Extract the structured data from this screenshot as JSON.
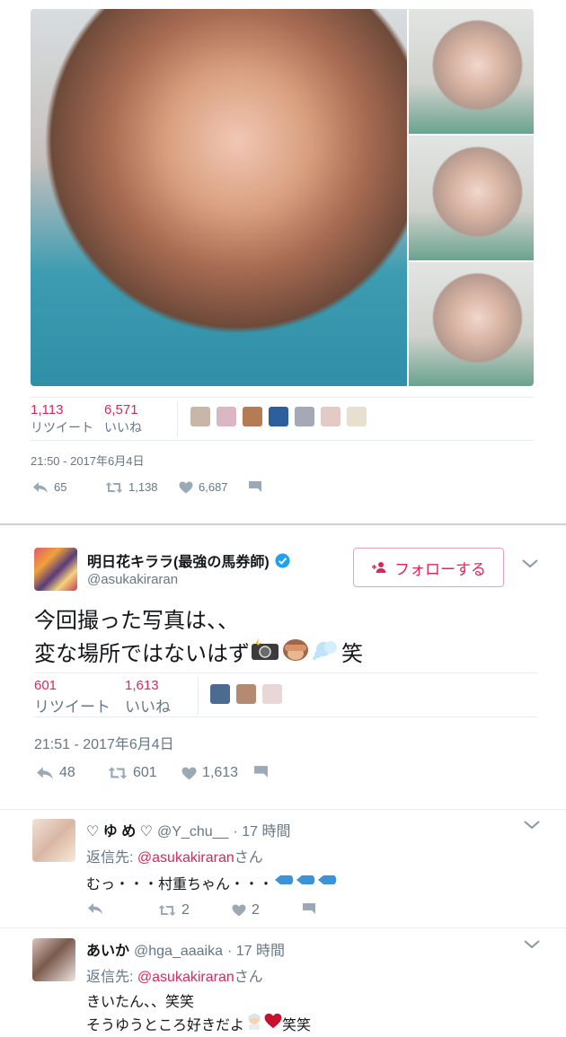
{
  "tweet1": {
    "retweets_count": "1,113",
    "retweets_label": "リツイート",
    "likes_count": "6,571",
    "likes_label": "いいね",
    "timestamp": "21:50 - 2017年6月4日",
    "actions": {
      "reply": "65",
      "retweet": "1,138",
      "like": "6,687"
    }
  },
  "tweet2": {
    "display_name": "明日花キララ(最強の馬券師)",
    "handle": "@asukakiraran",
    "follow_label": "フォローする",
    "text_line1": "今回撮った写真は、、",
    "text_line2": "変な場所ではないはず",
    "text_line2_end": "笑",
    "retweets_count": "601",
    "retweets_label": "リツイート",
    "likes_count": "1,613",
    "likes_label": "いいね",
    "timestamp": "21:51 - 2017年6月4日",
    "actions": {
      "reply": "48",
      "retweet": "601",
      "like": "1,613"
    }
  },
  "replies": [
    {
      "name": "♡ ゆ め ♡",
      "handle": "@Y_chu__",
      "time": "· 17 時間",
      "reply_to_prefix": "返信先: ",
      "reply_to_handle": "@asukakiraran",
      "reply_to_suffix": "さん",
      "text_line1": "むっ・・・村重ちゃん・・・",
      "actions": {
        "retweet": "2",
        "like": "2"
      }
    },
    {
      "name": "あいか",
      "handle": "@hga_aaaika",
      "time": "· 17 時間",
      "reply_to_prefix": "返信先: ",
      "reply_to_handle": "@asukakiraran",
      "reply_to_suffix": "さん",
      "text_line1": "きいたん、、笑笑",
      "text_line2": "そうゆうところ好きだよ",
      "text_line2_end": "笑笑"
    }
  ]
}
